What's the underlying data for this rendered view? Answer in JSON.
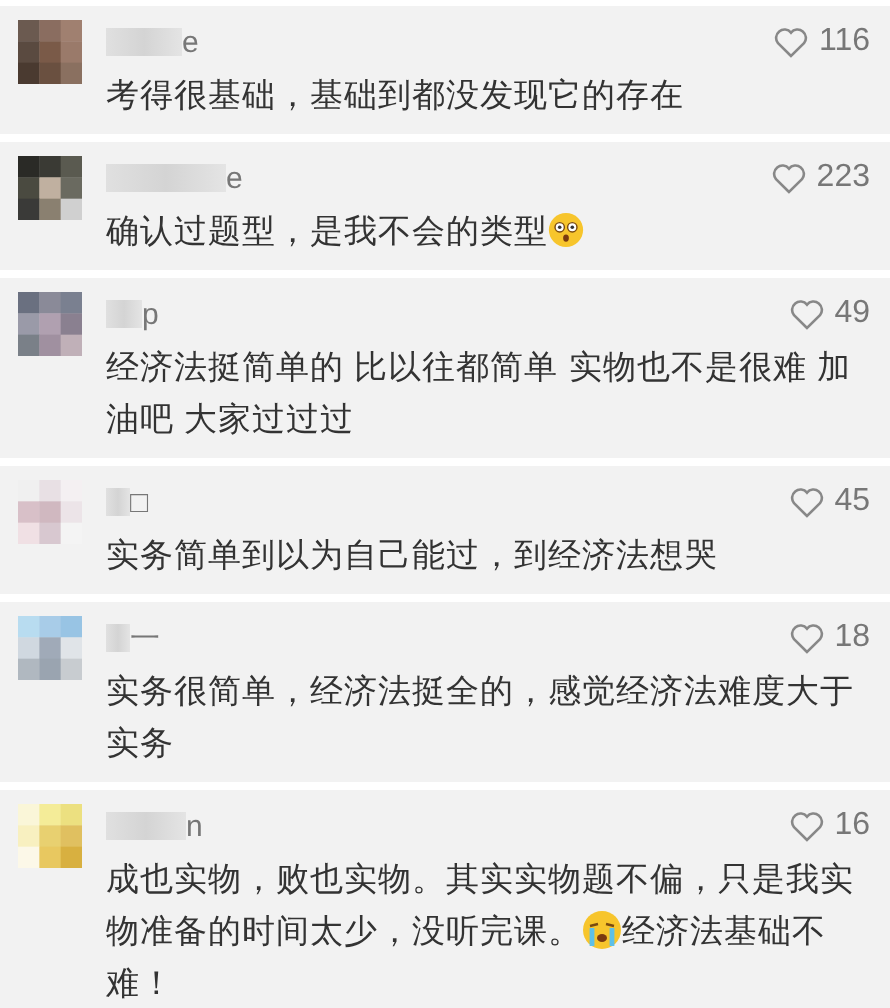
{
  "comments": [
    {
      "name": "e",
      "likes": "116",
      "text": [
        {
          "kind": "text",
          "text": "考得很基础，基础到都没发现它的存在"
        }
      ]
    },
    {
      "name": "e",
      "likes": "223",
      "text": [
        {
          "kind": "text",
          "text": "确认过题型，是我不会的类型"
        },
        {
          "kind": "shocked-emoji"
        }
      ]
    },
    {
      "name": "p",
      "likes": "49",
      "text": [
        {
          "kind": "text",
          "text": "经济法挺简单的 比以往都简单 实物也不是很难 加油吧 大家过过过"
        }
      ]
    },
    {
      "name": "□",
      "likes": "45",
      "text": [
        {
          "kind": "text",
          "text": "实务简单到以为自己能过，到经济法想哭"
        }
      ]
    },
    {
      "name": "一",
      "likes": "18",
      "text": [
        {
          "kind": "text",
          "text": "实务很简单，经济法挺全的，感觉经济法难度大于实务"
        }
      ]
    },
    {
      "name": "n",
      "likes": "16",
      "text": [
        {
          "kind": "text",
          "text": "成也实物，败也实物。其实实物题不偏，只是我实"
        },
        {
          "kind": "text",
          "text": "物准备的时间太少，没听完课。"
        },
        {
          "kind": "crying-emoji"
        },
        {
          "kind": "text",
          "text": "经济法基础不"
        },
        {
          "kind": "text",
          "text": "难！"
        }
      ]
    }
  ]
}
